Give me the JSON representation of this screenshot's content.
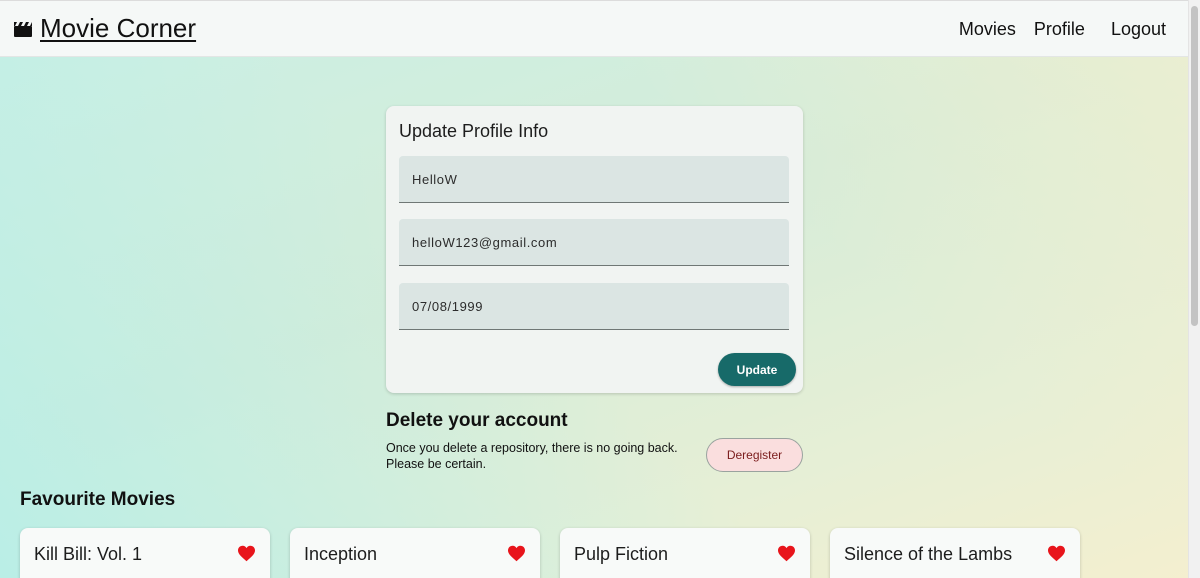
{
  "navbar": {
    "brand_icon": "clapperboard-icon",
    "brand_title": "Movie Corner",
    "links": [
      "Movies",
      "Profile",
      "Logout"
    ]
  },
  "profile_form": {
    "title": "Update Profile Info",
    "username_value": "HelloW",
    "email_value": "helloW123@gmail.com",
    "birthday_value": "07/08/1999",
    "update_label": "Update"
  },
  "delete_section": {
    "title": "Delete your account",
    "text_line1": "Once you delete a repository, there is no going back.",
    "text_line2": "Please be certain.",
    "button_label": "Deregister"
  },
  "favourites": {
    "title": "Favourite Movies",
    "movies": [
      "Kill Bill: Vol. 1",
      "Inception",
      "Pulp Fiction",
      "Silence of the Lambs"
    ],
    "heart_icon": "heart-icon",
    "heart_color": "#e8141b"
  },
  "colors": {
    "accent": "#176a69",
    "deregister_bg": "#fadede"
  }
}
